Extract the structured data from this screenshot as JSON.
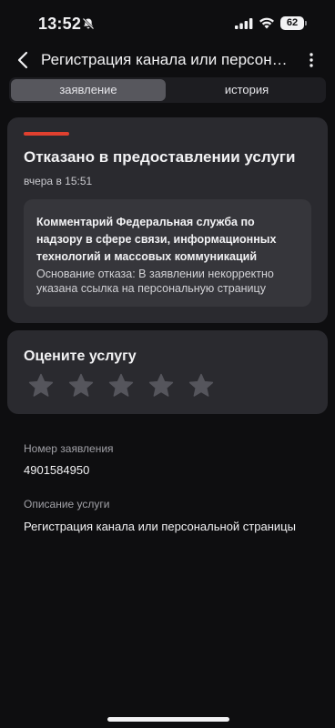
{
  "status_bar": {
    "time": "13:52",
    "battery": "62"
  },
  "nav": {
    "title": "Регистрация канала или персональной страницы"
  },
  "tabs": [
    {
      "label": "заявление",
      "active": true
    },
    {
      "label": "история",
      "active": false
    }
  ],
  "status_card": {
    "accent_color": "#e0402f",
    "title": "Отказано в предоставлении услуги",
    "time": "вчера в 15:51",
    "comment_title": "Комментарий Федеральная служба по надзору в сфере связи, информационных технологий и массовых коммуникаций",
    "comment_reason": "Основание отказа: В заявлении некорректно указана ссылка на персональную страницу"
  },
  "rating": {
    "title": "Оцените услугу",
    "max_stars": 5,
    "selected": 0
  },
  "details": {
    "number_label": "Номер заявления",
    "number_value": "4901584950",
    "description_label": "Описание услуги",
    "description_value": "Регистрация канала или персональной страницы"
  }
}
